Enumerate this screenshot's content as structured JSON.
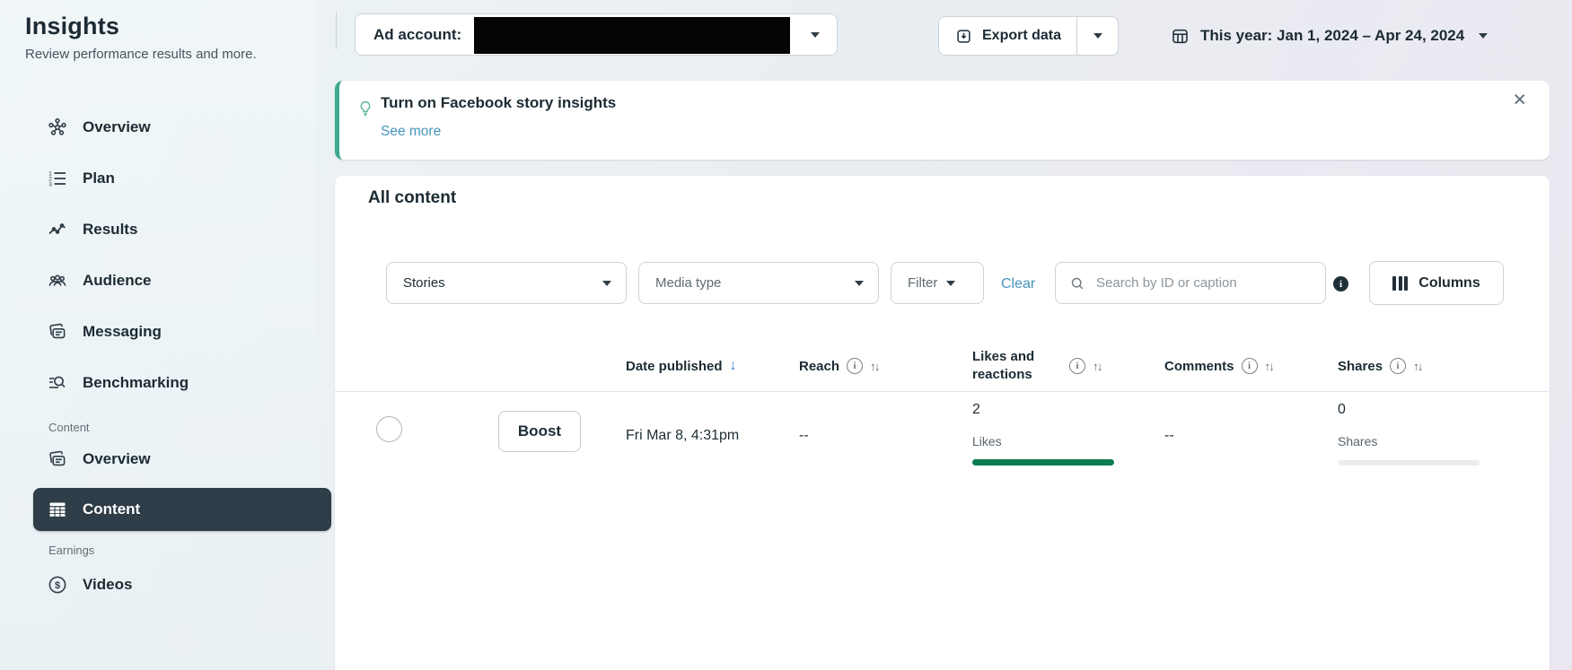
{
  "app": {
    "title": "Insights",
    "subtitle": "Review performance results and more."
  },
  "sidebar": {
    "nav": [
      {
        "label": "Overview",
        "icon": "hub-icon"
      },
      {
        "label": "Plan",
        "icon": "ordered-list-icon"
      },
      {
        "label": "Results",
        "icon": "line-chart-icon"
      },
      {
        "label": "Audience",
        "icon": "people-icon"
      },
      {
        "label": "Messaging",
        "icon": "cards-icon"
      },
      {
        "label": "Benchmarking",
        "icon": "benchmark-search-icon"
      }
    ],
    "content_section_label": "Content",
    "content_items": [
      {
        "label": "Overview",
        "icon": "cards-icon"
      },
      {
        "label": "Content",
        "icon": "table-icon",
        "selected": true
      }
    ],
    "earnings_section_label": "Earnings",
    "earnings_items": [
      {
        "label": "Videos",
        "icon": "dollar-circle-icon"
      }
    ]
  },
  "topbar": {
    "ad_account_label": "Ad account:",
    "ad_account_value_redacted": true,
    "export_label": "Export data",
    "date_range": "This year: Jan 1, 2024 – Apr 24, 2024"
  },
  "banner": {
    "title": "Turn on Facebook story insights",
    "link": "See more"
  },
  "main": {
    "heading": "All content",
    "filters": {
      "post_type_value": "Stories",
      "media_type_placeholder": "Media type",
      "filter_label": "Filter",
      "clear_label": "Clear",
      "search_placeholder": "Search by ID or caption",
      "columns_label": "Columns"
    },
    "table": {
      "headers": {
        "date": "Date published",
        "reach": "Reach",
        "likes": "Likes and reactions",
        "comments": "Comments",
        "shares": "Shares"
      },
      "sorted_by": "Date published (descending)",
      "row": {
        "boost_label": "Boost",
        "date": "Fri Mar 8, 4:31pm",
        "reach": "--",
        "likes_value": "2",
        "likes_label": "Likes",
        "comments": "--",
        "shares_value": "0",
        "shares_label": "Shares"
      }
    }
  },
  "glyphs": {
    "close": "×",
    "sort": "↑↓",
    "sorted_desc": "↓"
  },
  "colors": {
    "likes_bar": "#0a7c52",
    "shares_bar": "#e9edf0",
    "banner_accent": "#3fa98c",
    "link": "#4794bd",
    "selected_nav_bg": "#2e3d47",
    "sort_active_arrow": "#3b7de0"
  }
}
